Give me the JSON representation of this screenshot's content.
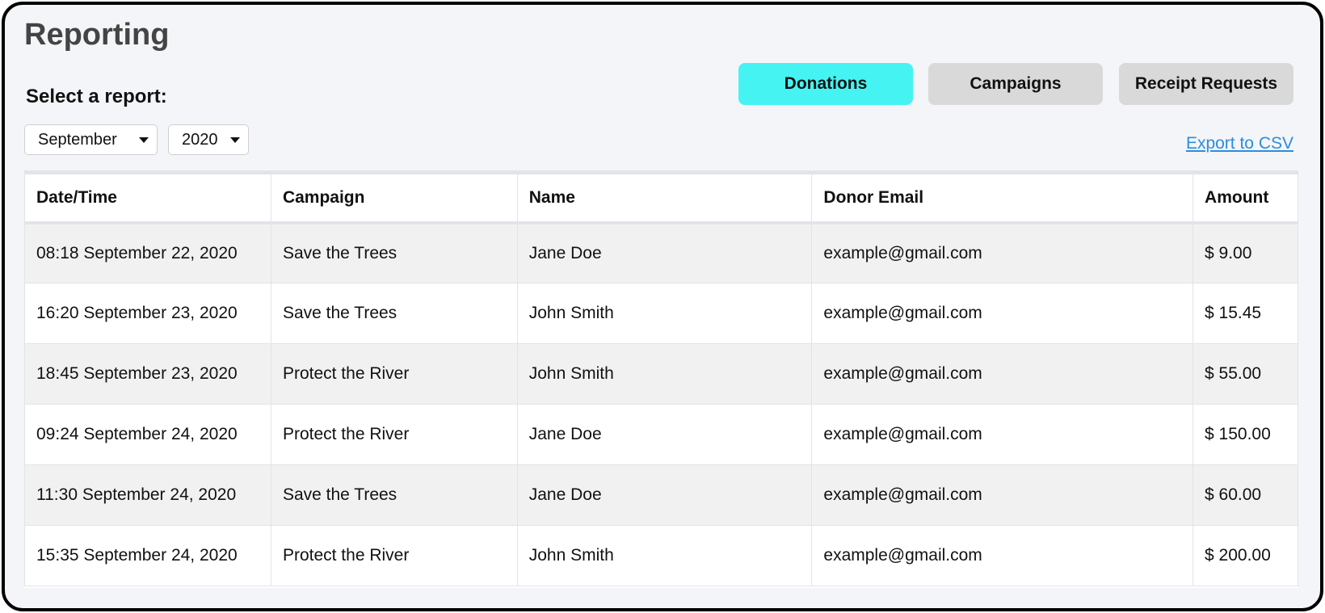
{
  "header": {
    "title": "Reporting",
    "select_label": "Select a report:"
  },
  "filters": {
    "month": "September",
    "year": "2020"
  },
  "tabs": [
    {
      "label": "Donations",
      "active": true,
      "color": "#45f3f3"
    },
    {
      "label": "Campaigns",
      "active": false,
      "color": "#d9d9d9"
    },
    {
      "label": "Receipt Requests",
      "active": false,
      "color": "#d9d9d9"
    }
  ],
  "export_label": "Export to CSV",
  "colors": {
    "active_tab": "#45f3f3",
    "inactive_tab": "#d9d9d9",
    "link": "#2b8de0"
  },
  "table": {
    "columns": [
      "Date/Time",
      "Campaign",
      "Name",
      "Donor Email",
      "Amount"
    ],
    "rows": [
      [
        "08:18 September 22, 2020",
        "Save the Trees",
        "Jane Doe",
        "example@gmail.com",
        "$ 9.00"
      ],
      [
        "16:20 September 23, 2020",
        "Save the Trees",
        "John Smith",
        "example@gmail.com",
        "$ 15.45"
      ],
      [
        "18:45 September 23, 2020",
        "Protect the River",
        "John Smith",
        "example@gmail.com",
        "$ 55.00"
      ],
      [
        "09:24 September 24, 2020",
        "Protect the River",
        "Jane Doe",
        "example@gmail.com",
        "$ 150.00"
      ],
      [
        "11:30 September 24, 2020",
        "Save the Trees",
        "Jane Doe",
        "example@gmail.com",
        "$ 60.00"
      ],
      [
        "15:35 September 24, 2020",
        "Protect the River",
        "John Smith",
        "example@gmail.com",
        "$ 200.00"
      ]
    ]
  }
}
